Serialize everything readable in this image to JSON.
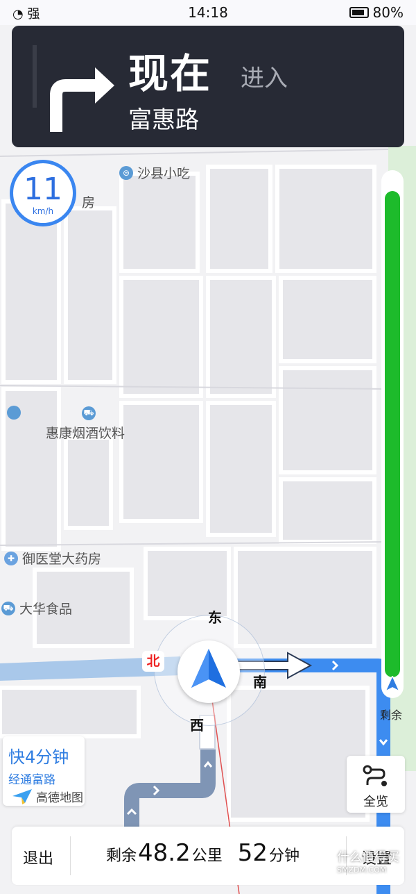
{
  "status_bar": {
    "signal": "强",
    "time": "14:18",
    "battery": "80%"
  },
  "navigation": {
    "instruction": "现在",
    "action": "进入",
    "road": "富惠路"
  },
  "speed": {
    "value": "11",
    "unit": "km/h"
  },
  "pois": {
    "shaxian": "沙县小吃",
    "fang": "房",
    "huikang": "惠康烟酒饮料",
    "yuyitang": "御医堂大药房",
    "dahua": "大华食品"
  },
  "compass": {
    "east": "东",
    "south": "南",
    "west": "西",
    "north": "北"
  },
  "route_progress": {
    "label": "剩余",
    "remaining_fraction": 0.97,
    "color": "#1dbb2b"
  },
  "alt_route": {
    "faster": "快4分钟",
    "via": "经通富路",
    "brand": "高德地图"
  },
  "overview_button": {
    "label": "全览"
  },
  "bottom_bar": {
    "exit": "退出",
    "remain_prefix": "剩余",
    "distance": "48.2",
    "distance_unit": "公里",
    "duration": "52",
    "duration_unit": "分钟",
    "settings": "设置"
  },
  "watermark": {
    "title": "什么值得买",
    "sub": "SMZDM.COM"
  },
  "colors": {
    "route_blue": "#3d8cf0",
    "nav_card": "#272a35",
    "accent": "#2f7de1"
  }
}
